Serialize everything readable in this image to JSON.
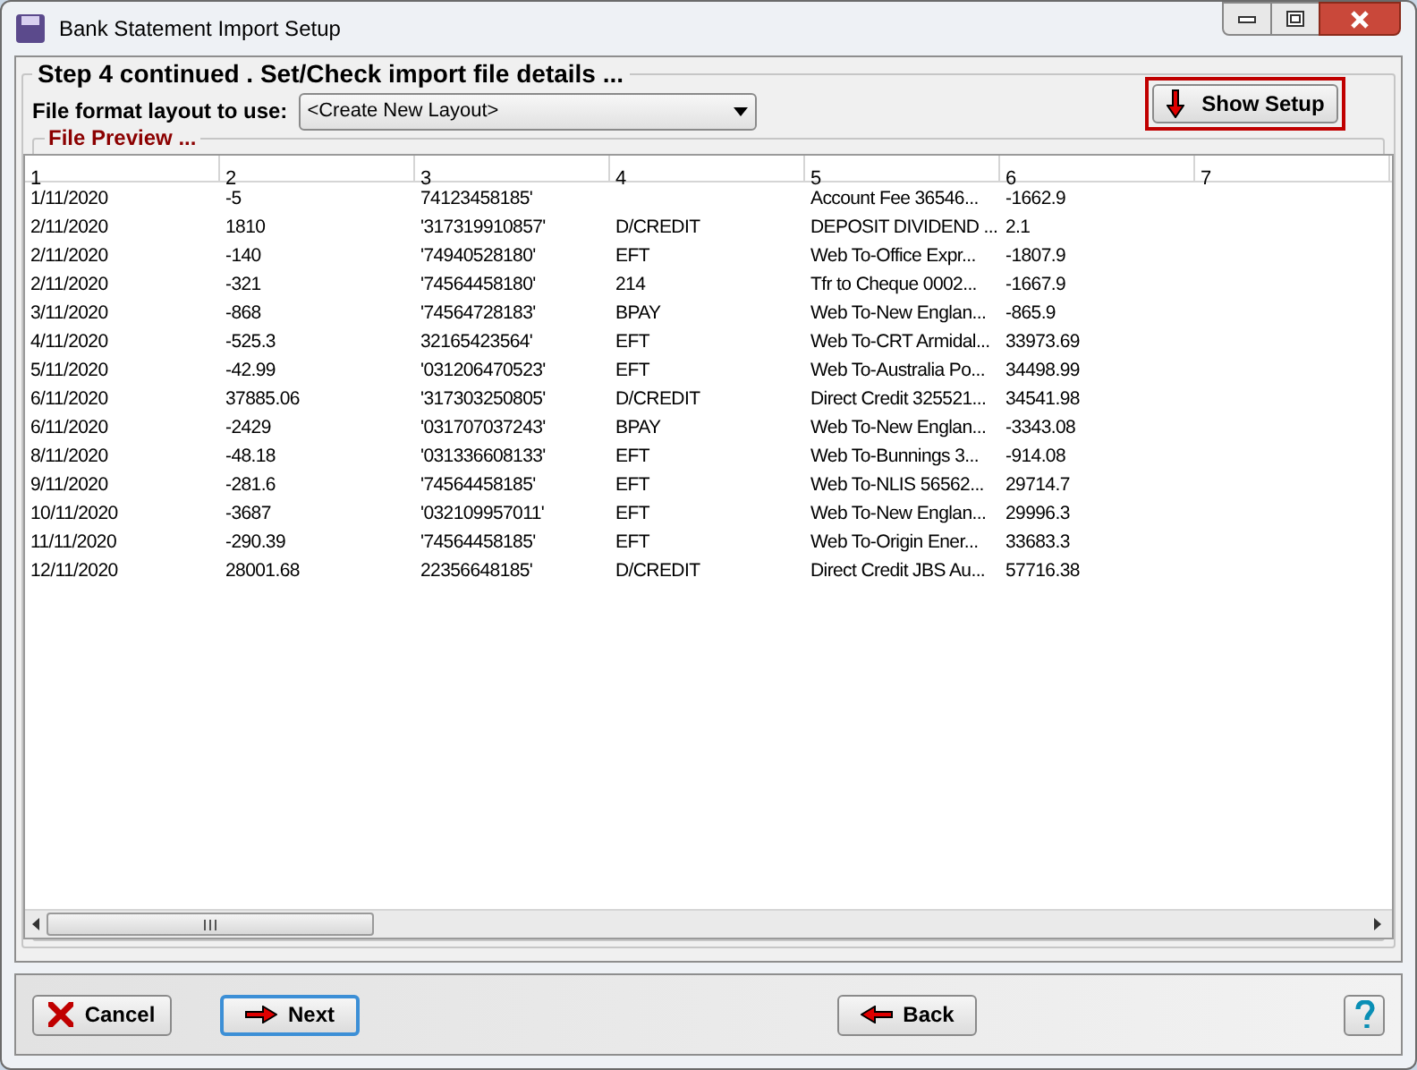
{
  "window": {
    "title": "Bank Statement Import Setup"
  },
  "step_title": "Step 4 continued . Set/Check import file details ...",
  "layout_select": {
    "label": "File format layout to use:",
    "value": "<Create New Layout>"
  },
  "show_setup_button": {
    "label": "Show Setup",
    "highlighted": true
  },
  "file_preview": {
    "title": "File Preview ...",
    "columns": [
      "1",
      "2",
      "3",
      "4",
      "5",
      "6",
      "7"
    ],
    "rows": [
      {
        "column_1": "1/11/2020",
        "column_2": "-5",
        "column_3": "74123458185'",
        "column_5": "Account Fee 36546...",
        "column_6": "-1662.9"
      },
      {
        "column_1": "2/11/2020",
        "column_2": "1810",
        "column_3": "'317319910857'",
        "column_4": "D/CREDIT",
        "column_5": "DEPOSIT DIVIDEND ...",
        "column_6": "2.1"
      },
      {
        "column_1": "2/11/2020",
        "column_2": "-140",
        "column_3": "'74940528180'",
        "column_4": "EFT",
        "column_5": "Web To-Office Expr...",
        "column_6": "-1807.9"
      },
      {
        "column_1": "2/11/2020",
        "column_2": "-321",
        "column_3": "'74564458180'",
        "column_4": "214",
        "column_5": "Tfr to Cheque 0002...",
        "column_6": "-1667.9"
      },
      {
        "column_1": "3/11/2020",
        "column_2": "-868",
        "column_3": "'74564728183'",
        "column_4": "BPAY",
        "column_5": "Web To-New Englan...",
        "column_6": "-865.9"
      },
      {
        "column_1": "4/11/2020",
        "column_2": "-525.3",
        "column_3": "32165423564'",
        "column_4": "EFT",
        "column_5": "Web To-CRT Armidal...",
        "column_6": "33973.69"
      },
      {
        "column_1": "5/11/2020",
        "column_2": "-42.99",
        "column_3": "'031206470523'",
        "column_4": "EFT",
        "column_5": "Web To-Australia Po...",
        "column_6": "34498.99"
      },
      {
        "column_1": "6/11/2020",
        "column_2": "37885.06",
        "column_3": "'317303250805'",
        "column_4": "D/CREDIT",
        "column_5": "Direct Credit 325521...",
        "column_6": "34541.98"
      },
      {
        "column_1": "6/11/2020",
        "column_2": "-2429",
        "column_3": "'031707037243'",
        "column_4": "BPAY",
        "column_5": "Web To-New Englan...",
        "column_6": "-3343.08"
      },
      {
        "column_1": "8/11/2020",
        "column_2": "-48.18",
        "column_3": "'031336608133'",
        "column_4": "EFT",
        "column_5": "Web To-Bunnings 3...",
        "column_6": "-914.08"
      },
      {
        "column_1": "9/11/2020",
        "column_2": "-281.6",
        "column_3": "'74564458185'",
        "column_4": "EFT",
        "column_5": "Web To-NLIS 56562...",
        "column_6": "29714.7"
      },
      {
        "column_1": "10/11/2020",
        "column_2": "-3687",
        "column_3": "'032109957011'",
        "column_4": "EFT",
        "column_5": "Web To-New Englan...",
        "column_6": "29996.3"
      },
      {
        "column_1": "11/11/2020",
        "column_2": "-290.39",
        "column_3": "'74564458185'",
        "column_4": "EFT",
        "column_5": "Web To-Origin Ener...",
        "column_6": "33683.3"
      },
      {
        "column_1": "12/11/2020",
        "column_2": "28001.68",
        "column_3": "22356648185'",
        "column_4": "D/CREDIT",
        "column_5": "Direct Credit JBS Au...",
        "column_6": "57716.38"
      }
    ]
  },
  "buttons": [
    {
      "label": "Cancel",
      "kind": "cancel",
      "focused": false
    },
    {
      "label": "Next",
      "kind": "next",
      "focused": true
    },
    {
      "label": "Back",
      "kind": "back",
      "focused": false
    }
  ]
}
